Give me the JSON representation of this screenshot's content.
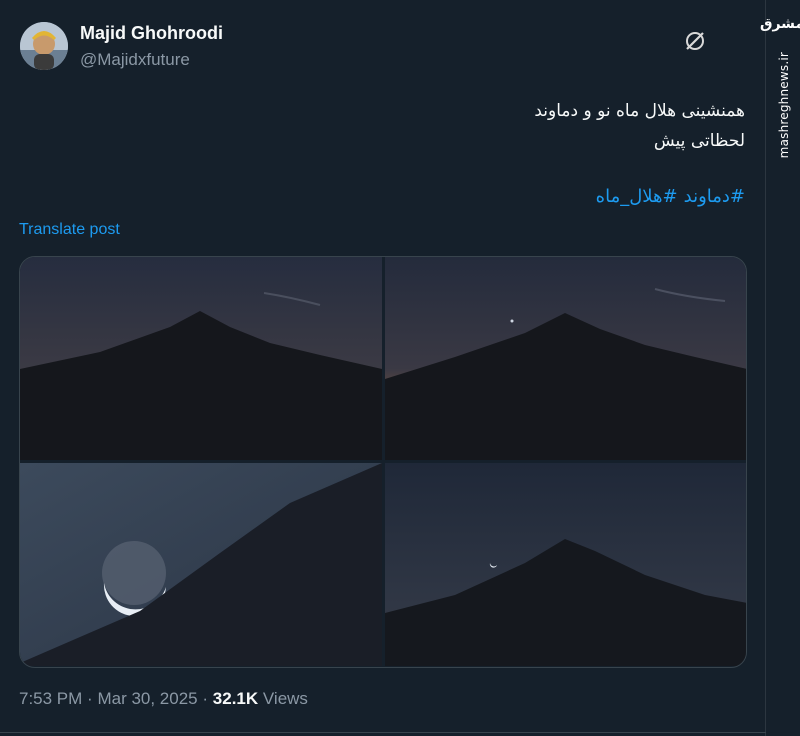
{
  "author": {
    "name": "Majid Ghohroodi",
    "handle": "@Majidxfuture"
  },
  "watermark": {
    "logo_text": "مشرق",
    "site": "mashreghnews.ir"
  },
  "tweet": {
    "line1": "همنشینی هلال ماه نو و دماوند",
    "line2": "لحظاتی پیش",
    "hashtags": [
      "#دماوند",
      "#هلال_ماه"
    ],
    "translate_label": "Translate post"
  },
  "meta": {
    "time": "7:53 PM",
    "date": "Mar 30, 2025",
    "views_count": "32.1K",
    "views_label": "Views",
    "separator": "·"
  },
  "media": {
    "count": 4,
    "subject": "Damavand with new crescent moon"
  },
  "colors": {
    "background": "#15202b",
    "link": "#1d9bf0",
    "muted": "#8b98a5"
  }
}
